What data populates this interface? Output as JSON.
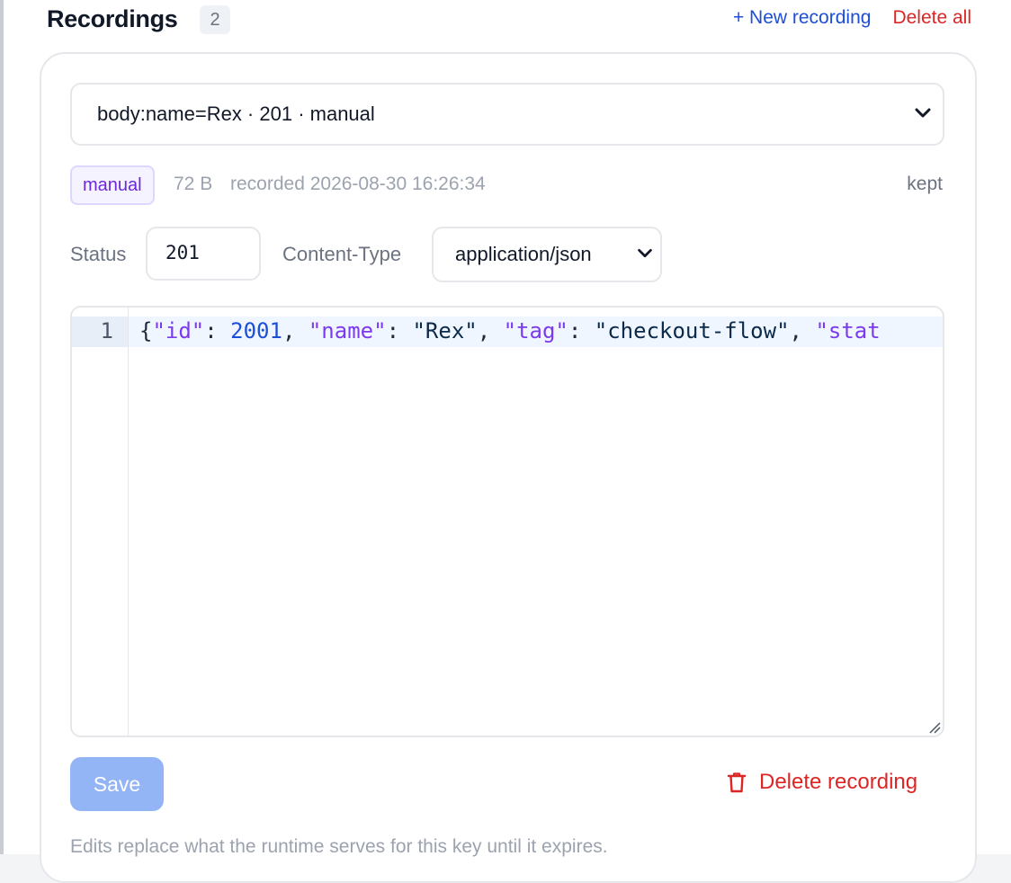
{
  "header": {
    "title": "Recordings",
    "count": "2",
    "new_label": "+ New recording",
    "delete_all_label": "Delete all"
  },
  "recording_select": {
    "selected": "body:name=Rex · 201 · manual"
  },
  "meta": {
    "tag": "manual",
    "size": "72 B",
    "recorded": "recorded 2026-08-30 16:26:34",
    "kept": "kept"
  },
  "form": {
    "status_label": "Status",
    "status_value": "201",
    "content_type_label": "Content-Type",
    "content_type_value": "application/json"
  },
  "editor": {
    "line_number": "1",
    "tokens": {
      "t1": "{",
      "t2": "\"id\"",
      "t3": ": ",
      "t4": "2001",
      "t5": ", ",
      "t6": "\"name\"",
      "t7": ": ",
      "t8": "\"Rex\"",
      "t9": ", ",
      "t10": "\"tag\"",
      "t11": ": ",
      "t12": "\"checkout-flow\"",
      "t13": ", ",
      "t14": "\"stat"
    }
  },
  "actions": {
    "save_label": "Save",
    "delete_recording_label": "Delete recording"
  },
  "footnote": "Edits replace what the runtime serves for this key until it expires.",
  "colors": {
    "accent_blue": "#1d4ed8",
    "danger_red": "#dc2626",
    "tag_purple": "#6d28d9",
    "save_disabled": "#93b4f5"
  },
  "icons": {
    "select_chevron": "chevron-down-icon",
    "delete_recording": "trash-icon",
    "editor_resize": "resize-handle-icon"
  }
}
